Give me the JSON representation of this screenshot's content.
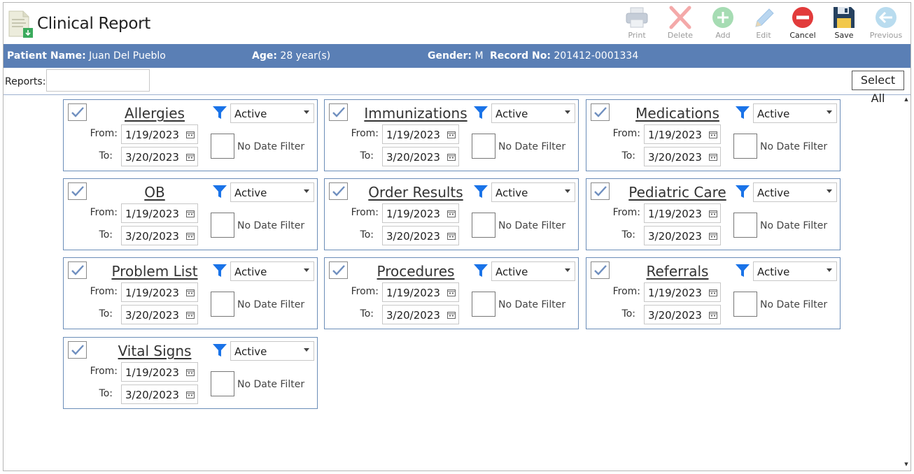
{
  "app": {
    "title": "Clinical Report"
  },
  "toolbar": [
    {
      "label": "Print",
      "icon": "printer-icon",
      "enabled": false
    },
    {
      "label": "Delete",
      "icon": "delete-x-icon",
      "enabled": false
    },
    {
      "label": "Add",
      "icon": "add-plus-icon",
      "enabled": false
    },
    {
      "label": "Edit",
      "icon": "pencil-icon",
      "enabled": false
    },
    {
      "label": "Cancel",
      "icon": "cancel-minus-icon",
      "enabled": true
    },
    {
      "label": "Save",
      "icon": "floppy-disk-icon",
      "enabled": true
    },
    {
      "label": "Previous",
      "icon": "back-arrow-icon",
      "enabled": false
    }
  ],
  "patient": {
    "name_label": "Patient Name:",
    "name": "Juan Del Pueblo",
    "age_label": "Age:",
    "age": "28 year(s)",
    "gender_label": "Gender:",
    "gender": "M",
    "record_label": "Record No:",
    "record": "201412-0001334"
  },
  "reports": {
    "label": "Reports:",
    "value": "",
    "select_all": "Select All"
  },
  "labels": {
    "from": "From:",
    "to": "To:",
    "no_date_filter": "No Date Filter"
  },
  "cards": [
    {
      "title": "Allergies",
      "checked": true,
      "status": "Active",
      "from": "1/19/2023",
      "to": "3/20/2023",
      "no_date_filter": false
    },
    {
      "title": "Immunizations",
      "checked": true,
      "status": "Active",
      "from": "1/19/2023",
      "to": "3/20/2023",
      "no_date_filter": false
    },
    {
      "title": "Medications",
      "checked": true,
      "status": "Active",
      "from": "1/19/2023",
      "to": "3/20/2023",
      "no_date_filter": false
    },
    {
      "title": "OB",
      "checked": true,
      "status": "Active",
      "from": "1/19/2023",
      "to": "3/20/2023",
      "no_date_filter": false
    },
    {
      "title": "Order Results",
      "checked": true,
      "status": "Active",
      "from": "1/19/2023",
      "to": "3/20/2023",
      "no_date_filter": false
    },
    {
      "title": "Pediatric Care",
      "checked": true,
      "status": "Active",
      "from": "1/19/2023",
      "to": "3/20/2023",
      "no_date_filter": false
    },
    {
      "title": "Problem List",
      "checked": true,
      "status": "Active",
      "from": "1/19/2023",
      "to": "3/20/2023",
      "no_date_filter": false
    },
    {
      "title": "Procedures",
      "checked": true,
      "status": "Active",
      "from": "1/19/2023",
      "to": "3/20/2023",
      "no_date_filter": false
    },
    {
      "title": "Referrals",
      "checked": true,
      "status": "Active",
      "from": "1/19/2023",
      "to": "3/20/2023",
      "no_date_filter": false
    },
    {
      "title": "Vital Signs",
      "checked": true,
      "status": "Active",
      "from": "1/19/2023",
      "to": "3/20/2023",
      "no_date_filter": false
    }
  ],
  "colors": {
    "header_bar": "#5a7fb5",
    "card_border": "#6b8db8",
    "funnel": "#1a73e8",
    "check": "#6f8fbf"
  }
}
